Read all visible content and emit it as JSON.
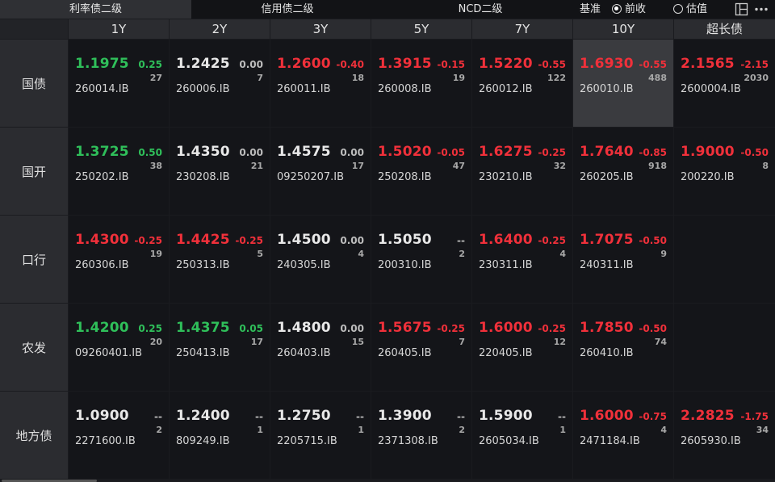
{
  "tabs": [
    {
      "label": "利率债二级",
      "active": true
    },
    {
      "label": "信用债二级",
      "active": false
    },
    {
      "label": "NCD二级",
      "active": false
    }
  ],
  "benchmark": {
    "label": "基准",
    "options": [
      {
        "label": "前收",
        "selected": true
      },
      {
        "label": "估值",
        "selected": false
      }
    ]
  },
  "toolbar_icons": [
    "layout-icon",
    "more-icon"
  ],
  "columns": [
    "1Y",
    "2Y",
    "3Y",
    "5Y",
    "7Y",
    "10Y",
    "超长债"
  ],
  "colors": {
    "up": "#f0303a",
    "down": "#2fbf5a",
    "neutral": "#e8e8e8",
    "highlight": "#3a3b3f"
  },
  "rows": [
    {
      "label": "国债",
      "cells": [
        {
          "yield": "1.1975",
          "change": "0.25",
          "volume": "27",
          "code": "260014.IB",
          "trend": "down"
        },
        {
          "yield": "1.2425",
          "change": "0.00",
          "volume": "7",
          "code": "260006.IB",
          "trend": "flat"
        },
        {
          "yield": "1.2600",
          "change": "-0.40",
          "volume": "18",
          "code": "260011.IB",
          "trend": "up"
        },
        {
          "yield": "1.3915",
          "change": "-0.15",
          "volume": "19",
          "code": "260008.IB",
          "trend": "up"
        },
        {
          "yield": "1.5220",
          "change": "-0.55",
          "volume": "122",
          "code": "260012.IB",
          "trend": "up"
        },
        {
          "yield": "1.6930",
          "change": "-0.55",
          "volume": "488",
          "code": "260010.IB",
          "trend": "up",
          "highlight": true
        },
        {
          "yield": "2.1565",
          "change": "-2.15",
          "volume": "2030",
          "code": "2600004.IB",
          "trend": "up"
        }
      ]
    },
    {
      "label": "国开",
      "cells": [
        {
          "yield": "1.3725",
          "change": "0.50",
          "volume": "38",
          "code": "250202.IB",
          "trend": "down"
        },
        {
          "yield": "1.4350",
          "change": "0.00",
          "volume": "21",
          "code": "230208.IB",
          "trend": "flat"
        },
        {
          "yield": "1.4575",
          "change": "0.00",
          "volume": "17",
          "code": "09250207.IB",
          "trend": "flat"
        },
        {
          "yield": "1.5020",
          "change": "-0.05",
          "volume": "47",
          "code": "250208.IB",
          "trend": "up"
        },
        {
          "yield": "1.6275",
          "change": "-0.25",
          "volume": "32",
          "code": "230210.IB",
          "trend": "up"
        },
        {
          "yield": "1.7640",
          "change": "-0.85",
          "volume": "918",
          "code": "260205.IB",
          "trend": "up"
        },
        {
          "yield": "1.9000",
          "change": "-0.50",
          "volume": "8",
          "code": "200220.IB",
          "trend": "up"
        }
      ]
    },
    {
      "label": "口行",
      "cells": [
        {
          "yield": "1.4300",
          "change": "-0.25",
          "volume": "19",
          "code": "260306.IB",
          "trend": "up"
        },
        {
          "yield": "1.4425",
          "change": "-0.25",
          "volume": "5",
          "code": "250313.IB",
          "trend": "up"
        },
        {
          "yield": "1.4500",
          "change": "0.00",
          "volume": "4",
          "code": "240305.IB",
          "trend": "flat"
        },
        {
          "yield": "1.5050",
          "change": "--",
          "volume": "2",
          "code": "200310.IB",
          "trend": "flat"
        },
        {
          "yield": "1.6400",
          "change": "-0.25",
          "volume": "4",
          "code": "230311.IB",
          "trend": "up"
        },
        {
          "yield": "1.7075",
          "change": "-0.50",
          "volume": "9",
          "code": "240311.IB",
          "trend": "up"
        },
        null
      ]
    },
    {
      "label": "农发",
      "cells": [
        {
          "yield": "1.4200",
          "change": "0.25",
          "volume": "20",
          "code": "09260401.IB",
          "trend": "down"
        },
        {
          "yield": "1.4375",
          "change": "0.05",
          "volume": "17",
          "code": "250413.IB",
          "trend": "down"
        },
        {
          "yield": "1.4800",
          "change": "0.00",
          "volume": "15",
          "code": "260403.IB",
          "trend": "flat"
        },
        {
          "yield": "1.5675",
          "change": "-0.25",
          "volume": "7",
          "code": "260405.IB",
          "trend": "up"
        },
        {
          "yield": "1.6000",
          "change": "-0.25",
          "volume": "12",
          "code": "220405.IB",
          "trend": "up"
        },
        {
          "yield": "1.7850",
          "change": "-0.50",
          "volume": "74",
          "code": "260410.IB",
          "trend": "up"
        },
        null
      ]
    },
    {
      "label": "地方债",
      "cells": [
        {
          "yield": "1.0900",
          "change": "--",
          "volume": "2",
          "code": "2271600.IB",
          "trend": "flat"
        },
        {
          "yield": "1.2400",
          "change": "--",
          "volume": "1",
          "code": "809249.IB",
          "trend": "flat"
        },
        {
          "yield": "1.2750",
          "change": "--",
          "volume": "1",
          "code": "2205715.IB",
          "trend": "flat"
        },
        {
          "yield": "1.3900",
          "change": "--",
          "volume": "2",
          "code": "2371308.IB",
          "trend": "flat"
        },
        {
          "yield": "1.5900",
          "change": "--",
          "volume": "1",
          "code": "2605034.IB",
          "trend": "flat"
        },
        {
          "yield": "1.6000",
          "change": "-0.75",
          "volume": "4",
          "code": "2471184.IB",
          "trend": "up"
        },
        {
          "yield": "2.2825",
          "change": "-1.75",
          "volume": "34",
          "code": "2605930.IB",
          "trend": "up"
        }
      ]
    }
  ]
}
